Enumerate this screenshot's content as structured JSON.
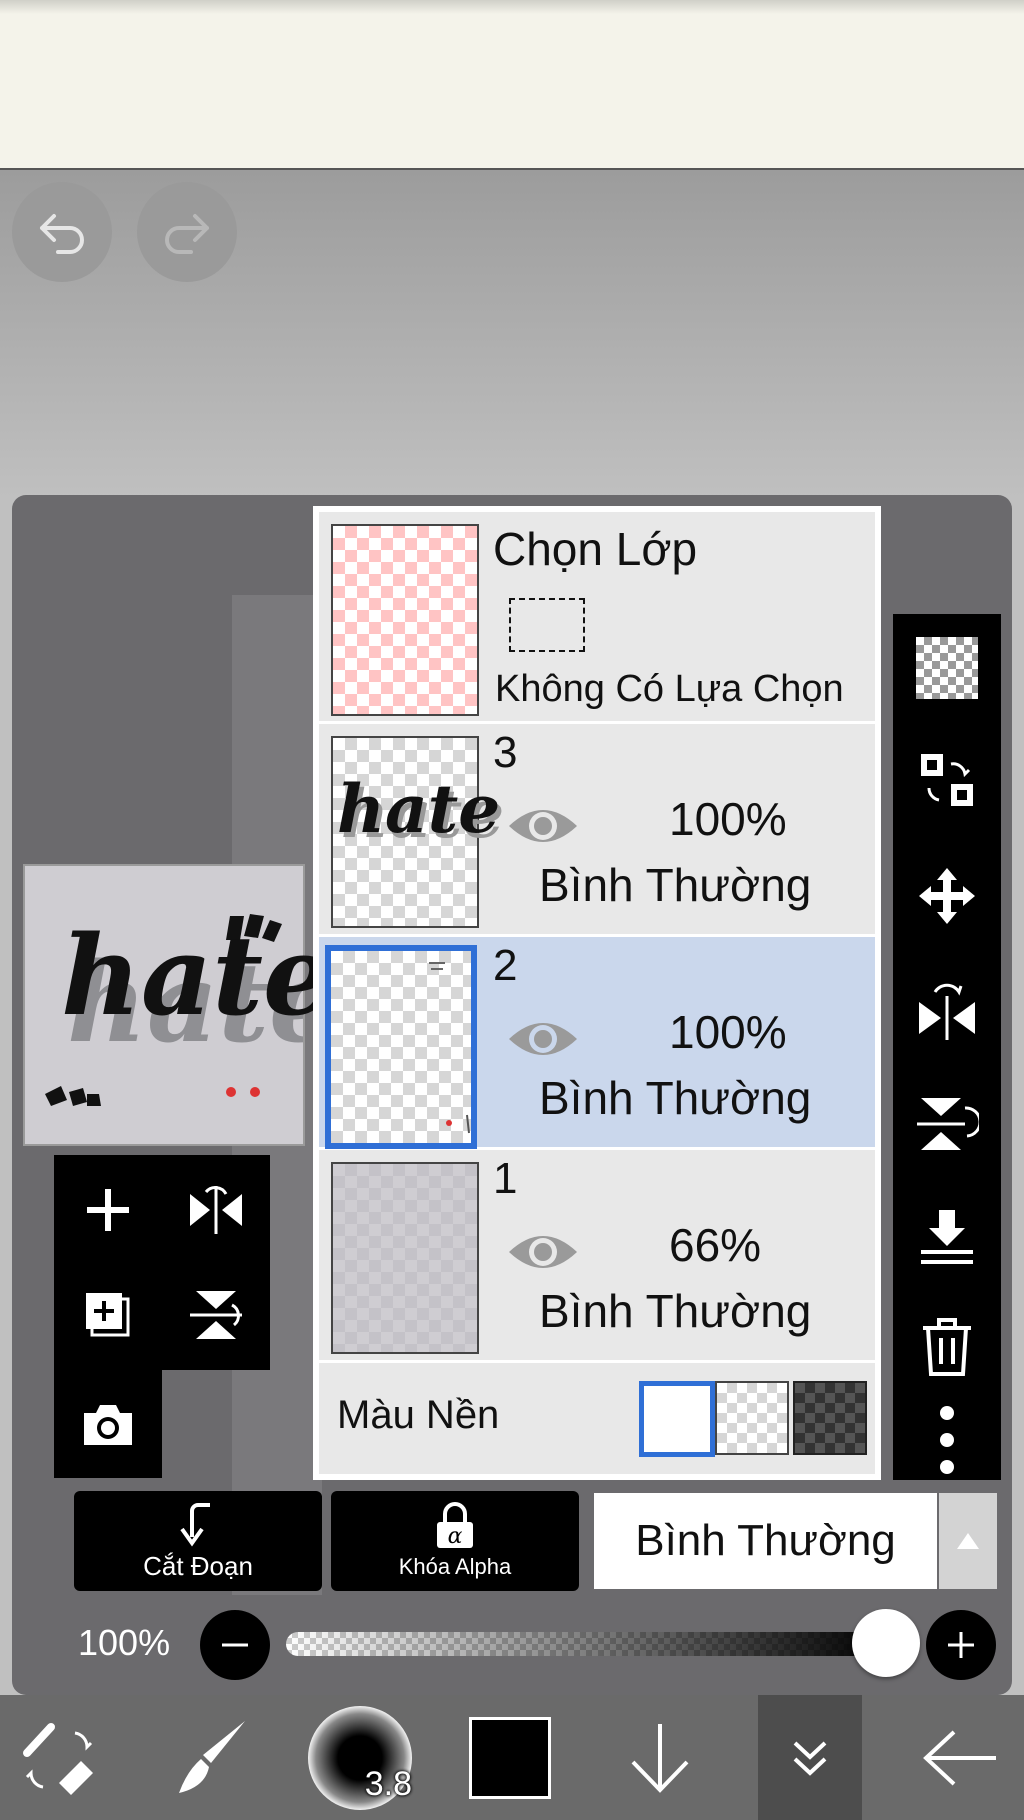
{
  "layers_panel": {
    "selection_layer": {
      "title": "Chọn Lớp",
      "subtitle": "Không Có Lựa Chọn"
    },
    "layers": [
      {
        "number": "3",
        "opacity": "100%",
        "blend": "Bình Thường",
        "selected": false
      },
      {
        "number": "2",
        "opacity": "100%",
        "blend": "Bình Thường",
        "selected": true
      },
      {
        "number": "1",
        "opacity": "66%",
        "blend": "Bình Thường",
        "selected": false
      }
    ],
    "background_label": "Màu Nền"
  },
  "preview": {
    "text": "hate"
  },
  "bottom_controls": {
    "clipping_label": "Cắt Đoạn",
    "alpha_lock_label": "Khóa Alpha",
    "blend_mode": "Bình Thường",
    "opacity_label": "100%"
  },
  "toolbar": {
    "brush_size": "3.8"
  },
  "colors": {
    "accent": "#2f6fd6",
    "selected_row": "#cad7ec",
    "selection_thumb": "#ffc4c4",
    "current_color": "#000000"
  }
}
